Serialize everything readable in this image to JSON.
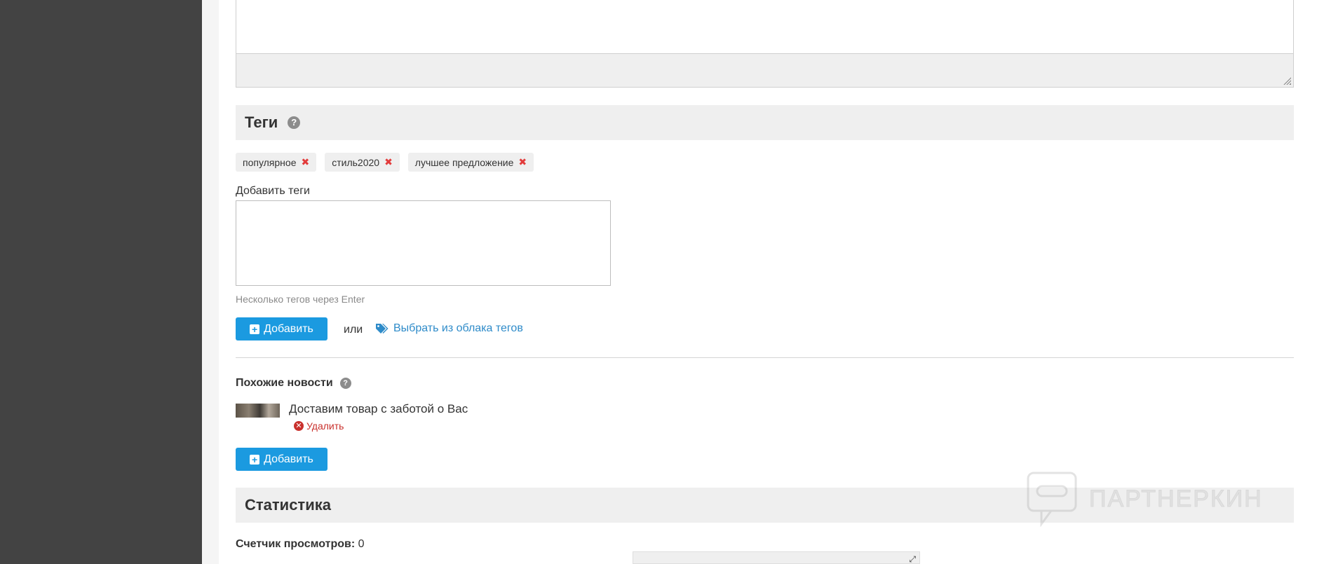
{
  "tags_section": {
    "title": "Теги",
    "help_icon": "question-circle-icon",
    "tags": [
      {
        "label": "популярное"
      },
      {
        "label": "стиль2020"
      },
      {
        "label": "лучшее предложение"
      }
    ],
    "remove_icon": "times-icon",
    "add_label": "Добавить теги",
    "input_value": "",
    "hint": "Несколько тегов через Enter",
    "add_button": "Добавить",
    "or_text": "или",
    "cloud_link": "Выбрать из облака тегов",
    "cloud_icon": "tags-icon"
  },
  "similar_news": {
    "title": "Похожие новости",
    "items": [
      {
        "title": "Доставим товар с заботой о Вас",
        "delete_label": "Удалить"
      }
    ],
    "add_button": "Добавить"
  },
  "statistics": {
    "title": "Статистика",
    "views_label": "Счетчик просмотров:",
    "views_value": "0"
  },
  "watermark": {
    "text": "ПАРТНЕРКИН"
  },
  "colors": {
    "sidebar": "#434343",
    "primary_button": "#1b9ae0",
    "link": "#2e8bc9",
    "danger": "#c9302c",
    "section_bg": "#efefef"
  }
}
